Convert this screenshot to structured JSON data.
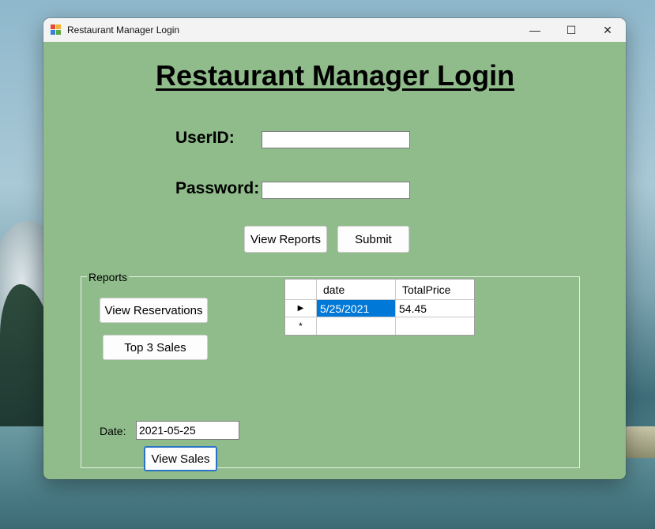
{
  "window": {
    "title": "Restaurant Manager Login",
    "controls": {
      "minimize": "—",
      "maximize": "☐",
      "close": "✕"
    }
  },
  "form": {
    "heading": "Restaurant Manager Login",
    "userid_label": "UserID:",
    "userid_value": "",
    "password_label": "Password:",
    "password_value": "",
    "view_reports_button": "View Reports",
    "submit_button": "Submit"
  },
  "reports": {
    "group_label": "Reports",
    "view_reservations_button": "View Reservations",
    "top3_sales_button": "Top 3 Sales",
    "date_label": "Date:",
    "date_value": "2021-05-25",
    "view_sales_button": "View Sales"
  },
  "grid": {
    "columns": [
      "date",
      "TotalPrice"
    ],
    "rows": [
      {
        "date": "5/25/2021",
        "TotalPrice": "54.45",
        "indicator": "▶"
      }
    ],
    "new_row_indicator": "*"
  },
  "colors": {
    "form_background": "#8fbc8a",
    "selection": "#0078d7"
  }
}
